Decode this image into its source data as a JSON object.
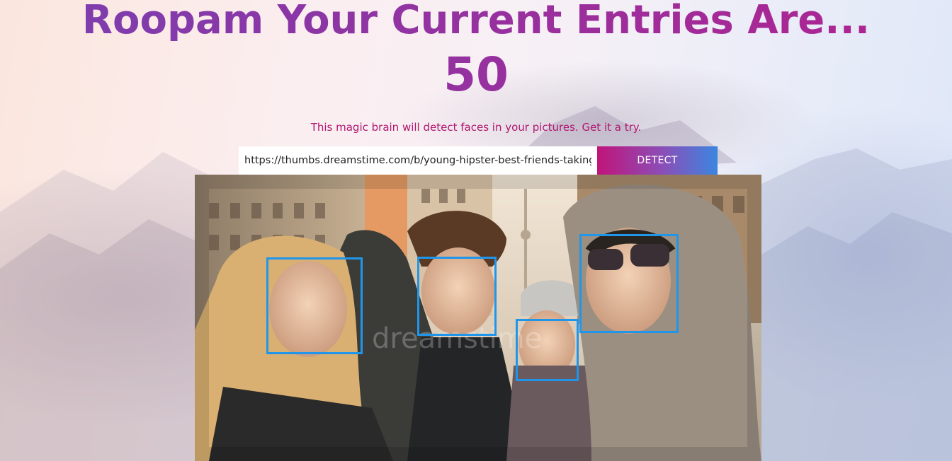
{
  "header": {
    "title": "Roopam Your Current Entries Are...",
    "entry_count": "50"
  },
  "subtitle": "This magic brain will detect faces in your pictures. Get it a try.",
  "form": {
    "image_url": "https://thumbs.dreamstime.com/b/young-hipster-best-friends-taking",
    "detect_label": "DETECT"
  },
  "result": {
    "watermark": "dreamstime",
    "face_count": 4,
    "box_color": "#1f96ea"
  },
  "colors": {
    "title_gradient_start": "#7a3fb0",
    "title_gradient_end": "#b1238f",
    "subtitle": "#b0166f",
    "button_gradient": [
      "#c0157a",
      "#8a4fb8",
      "#3b86e0"
    ]
  }
}
